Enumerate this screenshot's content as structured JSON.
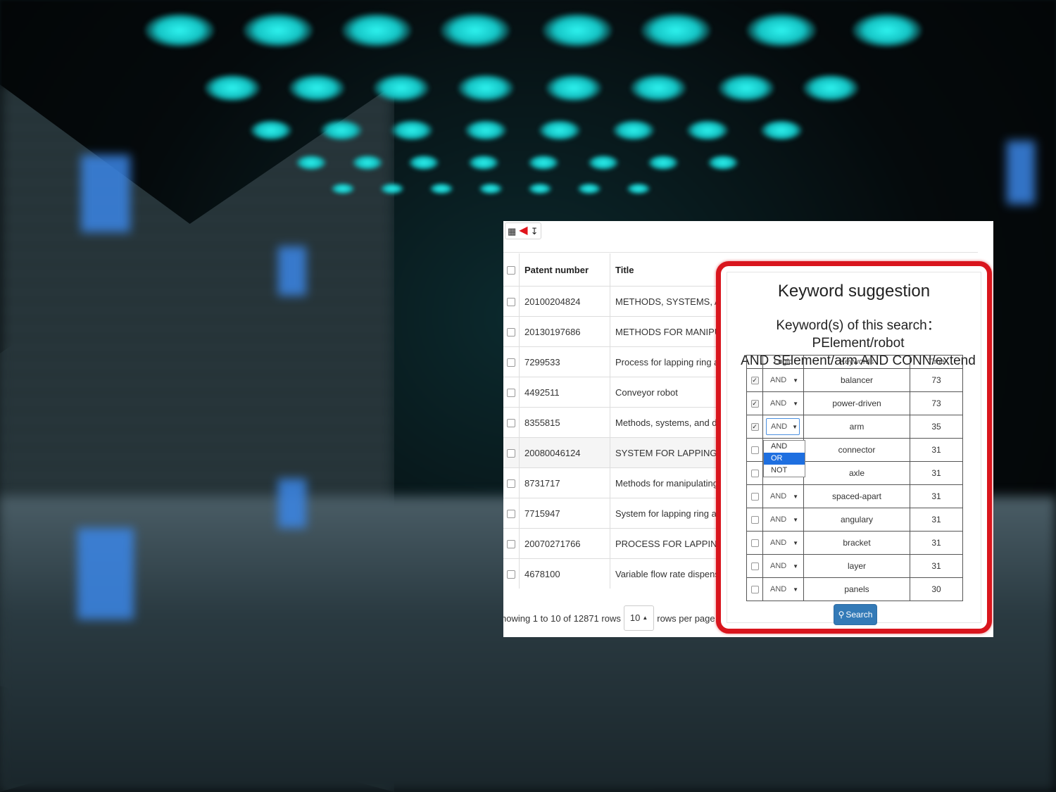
{
  "toolbar": {
    "icons": [
      "grid-icon",
      "back-arrow-icon",
      "export-icon"
    ]
  },
  "table": {
    "headers": {
      "patent_number": "Patent number",
      "title": "Title"
    },
    "rows": [
      {
        "number": "20100204824",
        "title": "METHODS, SYSTEMS, AND D"
      },
      {
        "number": "20130197686",
        "title": "METHODS FOR MANIPULATI"
      },
      {
        "number": "7299533",
        "title": "Process for lapping ring and pi"
      },
      {
        "number": "4492511",
        "title": "Conveyor robot"
      },
      {
        "number": "8355815",
        "title": "Methods, systems, and device"
      },
      {
        "number": "20080046124",
        "title": "SYSTEM FOR LAPPING RING"
      },
      {
        "number": "8731717",
        "title": "Methods for manipulating cutti"
      },
      {
        "number": "7715947",
        "title": "System for lapping ring and pir"
      },
      {
        "number": "20070271766",
        "title": "PROCESS FOR LAPPING RIN"
      },
      {
        "number": "4678100",
        "title": "Variable flow rate dispensing v"
      }
    ]
  },
  "pagination": {
    "showing": "howing 1 to 10 of 12871 rows",
    "page_size": "10",
    "rows_per_page": "rows per page"
  },
  "keyword_suggestion": {
    "title": "Keyword suggestion",
    "subtitle_line1": "Keyword(s) of this search：PElement/robot",
    "subtitle_line2": "AND SElement/arm AND CONN/extend",
    "headers": {
      "logic": "Logic",
      "keywords": "Keywords",
      "time": "Time"
    },
    "rows": [
      {
        "checked": true,
        "logic": "AND",
        "keyword": "balancer",
        "time": "73"
      },
      {
        "checked": true,
        "logic": "AND",
        "keyword": "power-driven",
        "time": "73"
      },
      {
        "checked": true,
        "logic": "AND",
        "keyword": "arm",
        "time": "35"
      },
      {
        "checked": false,
        "logic": "",
        "keyword": "connector",
        "time": "31"
      },
      {
        "checked": false,
        "logic": "",
        "keyword": "axle",
        "time": "31"
      },
      {
        "checked": false,
        "logic": "AND",
        "keyword": "spaced-apart",
        "time": "31"
      },
      {
        "checked": false,
        "logic": "AND",
        "keyword": "angulary",
        "time": "31"
      },
      {
        "checked": false,
        "logic": "AND",
        "keyword": "bracket",
        "time": "31"
      },
      {
        "checked": false,
        "logic": "AND",
        "keyword": "layer",
        "time": "31"
      },
      {
        "checked": false,
        "logic": "AND",
        "keyword": "panels",
        "time": "30"
      }
    ],
    "dropdown_options": [
      "AND",
      "OR",
      "NOT"
    ],
    "dropdown_selected": "OR",
    "search_button": "Search",
    "frame_color": "#d9151d",
    "button_color": "#337ab7"
  }
}
